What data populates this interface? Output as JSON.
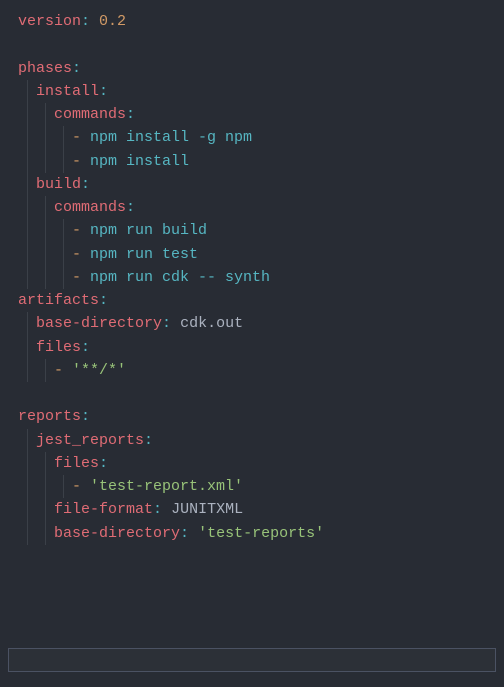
{
  "yaml": {
    "version_key": "version",
    "version_value": "0.2",
    "phases_key": "phases",
    "install_key": "install",
    "commands_key": "commands",
    "install_cmd1": "npm install -g npm",
    "install_cmd2": "npm install",
    "build_key": "build",
    "build_cmd1": "npm run build",
    "build_cmd2": "npm run test",
    "build_cmd3": "npm run cdk -- synth",
    "artifacts_key": "artifacts",
    "base_directory_key": "base-directory",
    "artifacts_base_dir": "cdk.out",
    "files_key": "files",
    "artifacts_file_glob": "'**/*'",
    "reports_key": "reports",
    "jest_reports_key": "jest_reports",
    "report_file": "'test-report.xml'",
    "file_format_key": "file-format",
    "file_format_value": "JUNITXML",
    "reports_base_dir": "'test-reports'"
  }
}
